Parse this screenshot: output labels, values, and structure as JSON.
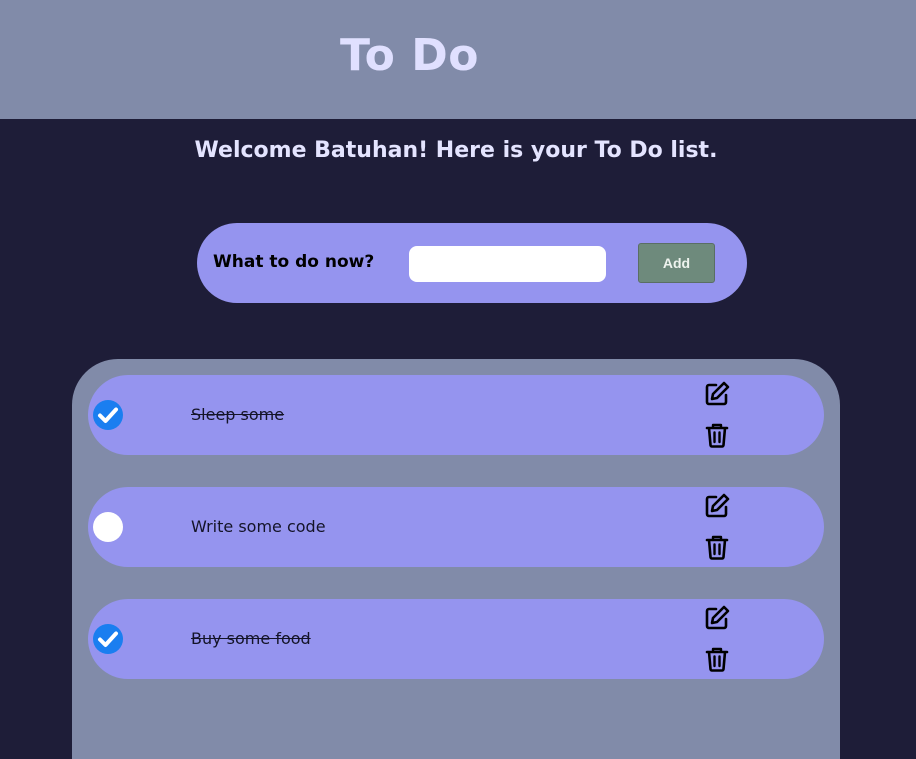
{
  "header": {
    "title": "To Do"
  },
  "welcome_text": "Welcome Batuhan! Here is your To Do list.",
  "add_form": {
    "label": "What to do now?",
    "input_value": "",
    "button_label": "Add"
  },
  "todos": [
    {
      "text": "Sleep some",
      "completed": true
    },
    {
      "text": "Write some code",
      "completed": false
    },
    {
      "text": "Buy some food",
      "completed": true
    }
  ],
  "colors": {
    "header_bg": "#818ba9",
    "page_bg": "#1e1d38",
    "card_bg": "#9594ef",
    "check_done": "#1a7ef0",
    "add_button": "#6e8a7c"
  },
  "icons": {
    "check": "check-icon",
    "edit": "edit-icon",
    "delete": "trash-icon"
  }
}
